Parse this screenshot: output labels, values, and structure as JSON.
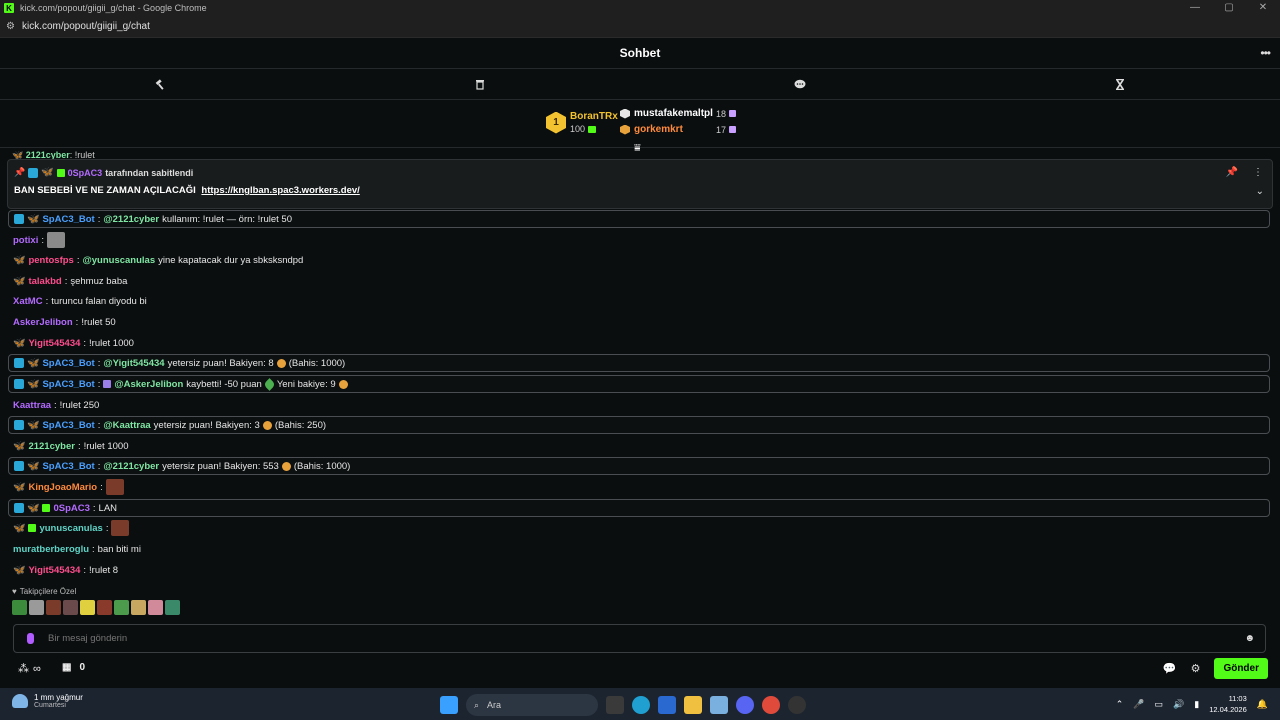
{
  "window": {
    "title": "kick.com/popout/giigii_g/chat - Google Chrome",
    "url": "kick.com/popout/giigii_g/chat"
  },
  "header": {
    "title": "Sohbet",
    "more_icon": "more-horizontal-icon"
  },
  "toolbar": {
    "icons": [
      "hammer-icon",
      "trash-icon",
      "chat-bubble-icon",
      "hourglass-icon"
    ]
  },
  "leaderboard": {
    "first": {
      "rank": "1",
      "name": "BoranTRx",
      "points": "100"
    },
    "second": {
      "name": "mustafakemaltpl",
      "count": "18"
    },
    "third": {
      "name": "gorkemkrt",
      "count": "17"
    }
  },
  "pinned": {
    "partial_user": "2121cyber",
    "partial_text": ": !rulet",
    "pinned_by_user": "0SpAC3",
    "pinned_by_text": "tarafından sabitlendi",
    "message": "BAN SEBEBİ VE NE ZAMAN AÇILACAĞI",
    "link": "https://knglban.spac3.workers.dev/"
  },
  "messages": [
    {
      "user": "SpAC3_Bot",
      "sep": ":",
      "mention": "@2121cyber",
      "text": "kullanım: !rulet — örn: !rulet 50"
    },
    {
      "user": "potixi",
      "sep": ":",
      "text": ""
    },
    {
      "user": "pentosfps",
      "sep": ":",
      "mention": "@yunuscanulas",
      "text": "yine kapatacak dur ya sbksksndpd"
    },
    {
      "user": "talakbd",
      "sep": ":",
      "text": "şehmuz baba"
    },
    {
      "user": "XatMC",
      "sep": ":",
      "text": "turuncu falan diyodu bi"
    },
    {
      "user": "AskerJelibon",
      "sep": ":",
      "text": "!rulet 50"
    },
    {
      "user": "Yigit545434",
      "sep": ":",
      "text": "!rulet 1000"
    },
    {
      "user": "SpAC3_Bot",
      "sep": ":",
      "mention": "@Yigit545434",
      "text": "yetersiz puan! Bakiyen: 8",
      "text2": "(Bahis: 1000)"
    },
    {
      "user": "SpAC3_Bot",
      "sep": ":",
      "mention": "@AskerJelibon",
      "text": "kaybetti! -50 puan",
      "text2": "Yeni bakiye: 9"
    },
    {
      "user": "Kaattraa",
      "sep": ":",
      "text": "!rulet 250"
    },
    {
      "user": "SpAC3_Bot",
      "sep": ":",
      "mention": "@Kaattraa",
      "text": "yetersiz puan! Bakiyen: 3",
      "text2": "(Bahis: 250)"
    },
    {
      "user": "2121cyber",
      "sep": ":",
      "text": "!rulet 1000"
    },
    {
      "user": "SpAC3_Bot",
      "sep": ":",
      "mention": "@2121cyber",
      "text": "yetersiz puan! Bakiyen: 553",
      "text2": "(Bahis: 1000)"
    },
    {
      "user": "KingJoaoMario",
      "sep": ":",
      "text": ""
    },
    {
      "user": "0SpAC3",
      "sep": ":",
      "text": "LAN"
    },
    {
      "user": "yunuscanulas",
      "sep": ":",
      "text": ""
    },
    {
      "user": "muratberberoglu",
      "sep": ":",
      "text": "ban biti mi"
    },
    {
      "user": "Yigit545434",
      "sep": ":",
      "text": "!rulet 8"
    }
  ],
  "colors": {
    "kick_green": "#53fc18",
    "bot_blue": "#4aa0ff",
    "pink": "#ff4d8d",
    "purple": "#b36bff",
    "orange": "#ff8a3d",
    "teal": "#5fd3c6",
    "gold": "#f2c230"
  },
  "emotes": {
    "label": "Takipçilere Özel"
  },
  "input": {
    "placeholder": "Bir mesaj gönderin"
  },
  "bottom": {
    "count": "0",
    "send_label": "Gönder"
  },
  "taskbar": {
    "weather_line1": "1 mm yağmur",
    "weather_line2": "Cumartesi",
    "search_label": "Ara",
    "time": "11:03",
    "date": "12.04.2026"
  }
}
